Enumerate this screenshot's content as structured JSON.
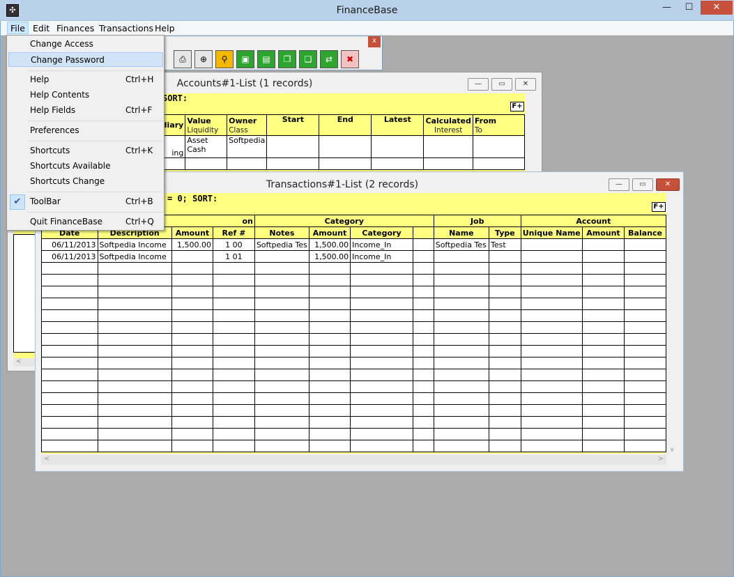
{
  "app": {
    "title": "FinanceBase",
    "controls": {
      "minimize": "—",
      "maximize": "☐",
      "close": "✕"
    }
  },
  "menubar": [
    "File",
    "Edit",
    "Finances",
    "Transactions",
    "Help"
  ],
  "file_menu": {
    "items": [
      {
        "label": "Change Access",
        "shortcut": ""
      },
      {
        "label": "Change Password",
        "shortcut": ""
      },
      {
        "label": "Help",
        "shortcut": "Ctrl+H"
      },
      {
        "label": "Help Contents",
        "shortcut": ""
      },
      {
        "label": "Help Fields",
        "shortcut": "Ctrl+F"
      },
      {
        "label": "Preferences",
        "shortcut": ""
      },
      {
        "label": "Shortcuts",
        "shortcut": "Ctrl+K"
      },
      {
        "label": "Shortcuts Available",
        "shortcut": ""
      },
      {
        "label": "Shortcuts Change",
        "shortcut": ""
      },
      {
        "label": "ToolBar",
        "shortcut": "Ctrl+B"
      },
      {
        "label": "Quit FinanceBase",
        "shortcut": "Ctrl+Q"
      }
    ],
    "toolbar_checked": true
  },
  "toolbar": {
    "close": "x"
  },
  "accounts_window": {
    "title": "Accounts#1-List (1 records)",
    "filter": "SORT:",
    "fplus": "F+",
    "headers": [
      {
        "main": "mediary",
        "sub": ""
      },
      {
        "main": "Value",
        "sub": "Liquidity"
      },
      {
        "main": "Owner",
        "sub": "Class"
      },
      {
        "main": "Start",
        "sub": ""
      },
      {
        "main": "End",
        "sub": ""
      },
      {
        "main": "Latest",
        "sub": ""
      },
      {
        "main": "Calculated",
        "sub": "Interest"
      },
      {
        "main": "From",
        "sub": "To"
      }
    ],
    "row": [
      "ing",
      "Asset\nCash",
      "Softpedia",
      "",
      "",
      "",
      "",
      ""
    ]
  },
  "transactions_window": {
    "title": "Transactions#1-List (2 records)",
    "filter": "= 0; SORT:",
    "fplus": "F+",
    "groups": [
      "on",
      "Category",
      "Job",
      "Account"
    ],
    "headers": [
      "Date",
      "Description",
      "Amount",
      "Ref #",
      "Notes",
      "Amount",
      "Category",
      "",
      "Name",
      "Type",
      "Unique Name",
      "Amount",
      "Balance"
    ],
    "rows": [
      [
        "06/11/2013",
        "Softpedia Income",
        "1,500.00",
        "1 00",
        "Softpedia Tes",
        "1,500.00",
        "Income_In",
        "",
        "Softpedia Tes",
        "Test",
        "",
        "",
        ""
      ],
      [
        "06/11/2013",
        "Softpedia Income",
        "",
        "1 01",
        "",
        "1,500.00",
        "Income_In",
        "",
        "",
        "",
        "",
        "",
        ""
      ]
    ]
  }
}
